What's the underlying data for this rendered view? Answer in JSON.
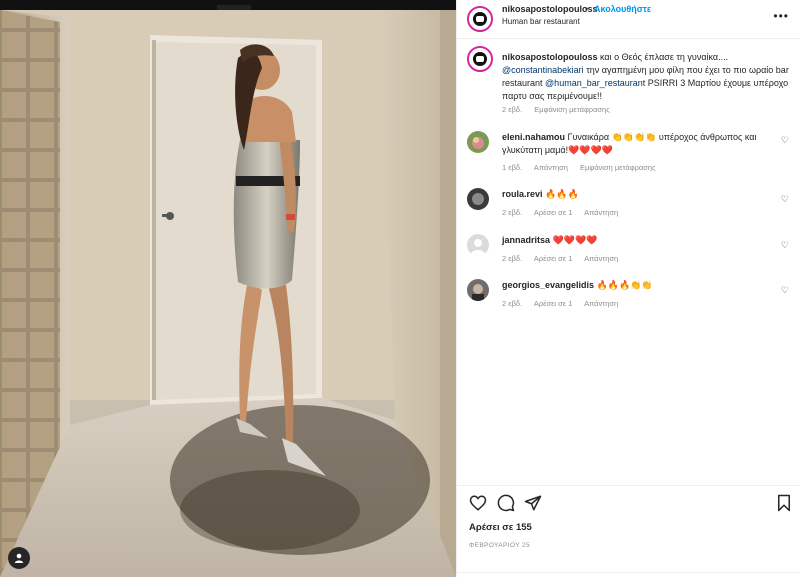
{
  "post": {
    "owner": "nikosapostolopouloss",
    "separator": "•",
    "follow_label": "Ακολουθήστε",
    "location": "Human bar restaurant",
    "more_icon": "more-horizontal-icon"
  },
  "caption": {
    "user": "nikosapostolopouloss",
    "text_1": "και ο Θεός έπλασε τη γυναίκα....",
    "mention_1": "@constantinabekiari",
    "text_2": "την αγαπημένη μου φίλη που έχει το πιο ωραίο bar restaurant",
    "mention_2": "@human_bar_restaurant",
    "text_3": "PSIRRI 3 Μαρτίου έχουμε υπέροχο παρτυ σας περιμένουμε!!",
    "age": "2 εβδ.",
    "translation_label": "Εμφάνιση μετάφρασης"
  },
  "comments": [
    {
      "user": "eleni.nahamou",
      "text": "Γυναικάρα 👏👏👏👏 υπέροχος άνθρωπος και γλυκύτατη μαμά!❤️❤️❤️❤️",
      "age": "1 εβδ.",
      "reply_label": "Απάντηση",
      "translation_label": "Εμφάνιση μετάφρασης"
    },
    {
      "user": "roula.revi",
      "text": "🔥🔥🔥",
      "age": "2 εβδ.",
      "likes_label": "Αρέσει σε 1",
      "reply_label": "Απάντηση"
    },
    {
      "user": "jannadritsa",
      "text": "❤️❤️❤️❤️",
      "age": "2 εβδ.",
      "likes_label": "Αρέσει σε 1",
      "reply_label": "Απάντηση"
    },
    {
      "user": "georgios_evangelidis",
      "text": "🔥🔥🔥👏👏",
      "age": "2 εβδ.",
      "likes_label": "Αρέσει σε 1",
      "reply_label": "Απάντηση"
    }
  ],
  "actions": {
    "likes": "Αρέσει σε 155",
    "date": "ΦΕΒΡΟΥΑΡΙΟΥ 25"
  },
  "colors": {
    "link": "#0095f6",
    "mention": "#00376b",
    "muted": "#8e8e8e",
    "heart": "#ed4956"
  }
}
